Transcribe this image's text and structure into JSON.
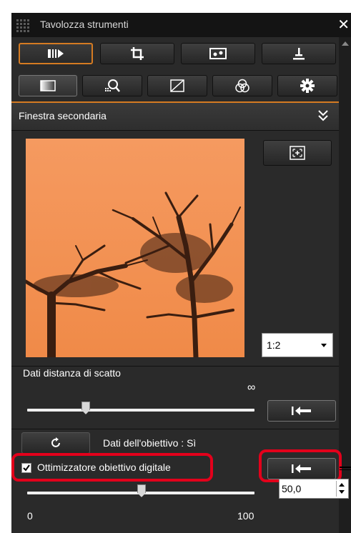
{
  "window": {
    "title": "Tavolozza strumenti",
    "close_glyph": "✕"
  },
  "tool_buttons": [
    {
      "icon": "adjust-icon",
      "active": true
    },
    {
      "icon": "crop-icon",
      "active": false
    },
    {
      "icon": "image-icon",
      "active": false
    },
    {
      "icon": "stamp-icon",
      "active": false
    }
  ],
  "tabs": [
    {
      "icon": "basic-adjust-icon",
      "active": true
    },
    {
      "icon": "lens-correction-icon",
      "active": false
    },
    {
      "icon": "tone-curve-icon",
      "active": false
    },
    {
      "icon": "color-adjust-icon",
      "active": false
    },
    {
      "icon": "settings-gear-icon",
      "active": false
    }
  ],
  "sub_window": {
    "title": "Finestra secondaria",
    "zoom_value": "1:2"
  },
  "shooting_distance": {
    "label": "Dati distanza di scatto",
    "infinity_symbol": "∞",
    "slider_value_fraction": 0.28
  },
  "lens_data": {
    "label": "Dati dell'obiettivo : Sì"
  },
  "digital_lens_optimizer": {
    "label": "Ottimizzatore obiettivo digitale",
    "checked": true,
    "value": "50,0",
    "slider_min_label": "0",
    "slider_max_label": "100",
    "slider_value": 50
  },
  "colors": {
    "accent": "#d57b22",
    "highlight": "#e3001b",
    "panel_bg": "#2a2a2a",
    "preview_orange": "#f2904f"
  }
}
